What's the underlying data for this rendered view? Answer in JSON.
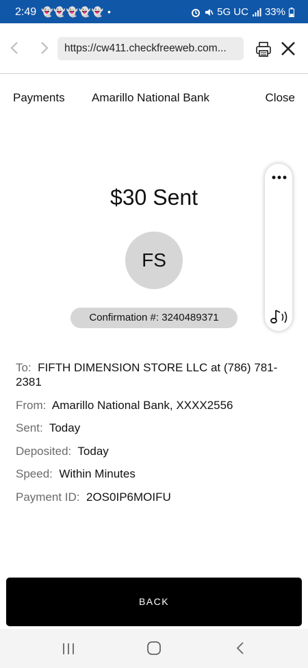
{
  "status_bar": {
    "time": "2:49",
    "notifications": "👻👻👻👻👻 •",
    "network": "5G UC",
    "battery": "33%"
  },
  "browser": {
    "url": "https://cw411.checkfreeweb.com..."
  },
  "header": {
    "payments_label": "Payments",
    "bank_name": "Amarillo National Bank",
    "close_label": "Close"
  },
  "confirmation": {
    "amount_sent": "$30 Sent",
    "payee_initials": "FS",
    "confirmation_label": "Confirmation #: 3240489371"
  },
  "details": {
    "to_label": "To:",
    "to_value": "FIFTH DIMENSION STORE LLC at (786) 781-2381",
    "from_label": "From:",
    "from_value": "Amarillo National Bank, XXXX2556",
    "sent_label": "Sent:",
    "sent_value": "Today",
    "deposited_label": "Deposited:",
    "deposited_value": "Today",
    "speed_label": "Speed:",
    "speed_value": "Within Minutes",
    "payment_id_label": "Payment ID:",
    "payment_id_value": "2OS0IP6MOIFU"
  },
  "back_button_label": "BACK",
  "colors": {
    "status_bar_bg": "#1157a8",
    "button_bg": "#000000",
    "pill_bg": "#d6d6d6"
  }
}
